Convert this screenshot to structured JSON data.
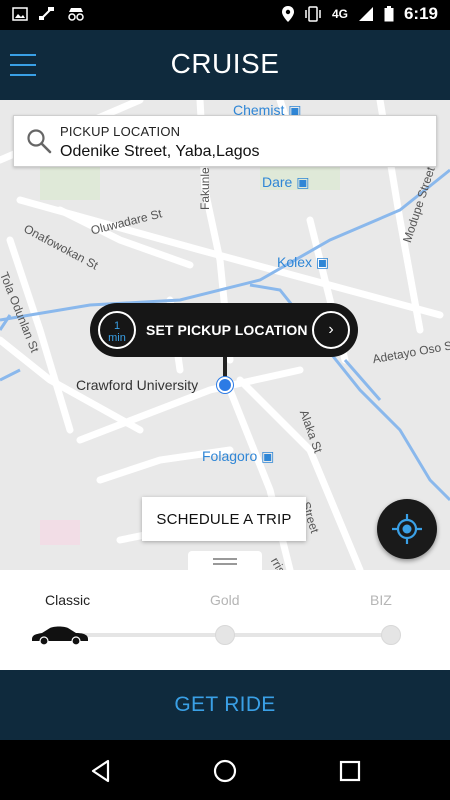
{
  "status_bar": {
    "network": "4G",
    "time": "6:19",
    "left_icons": [
      "image-icon",
      "satellite-icon",
      "incognito-icon"
    ],
    "right_icons": [
      "location-icon",
      "vibrate-icon",
      "signal-icon",
      "battery-icon"
    ]
  },
  "header": {
    "title": "CRUISE",
    "menu_icon": "hamburger-icon"
  },
  "map": {
    "streets": [
      "Oluwadare St",
      "Onafowokan St",
      "Fakunle Street",
      "Tola Odunlan St",
      "Modupe Street",
      "Adetayo Oso St",
      "Alaka St",
      "Street",
      "rris St"
    ],
    "places": {
      "chemist": "Chemist",
      "dare": "Dare",
      "kolex": "Kolex",
      "folagoro": "Folagoro",
      "crawford": "Crawford University"
    }
  },
  "pickup": {
    "label": "PICKUP LOCATION",
    "value": "Odenike Street, Yaba,Lagos",
    "icon": "search-icon"
  },
  "pickup_pill": {
    "eta_number": "1",
    "eta_unit": "min",
    "label": "SET PICKUP LOCATION",
    "arrow": "›"
  },
  "schedule_button": "SCHEDULE A TRIP",
  "locate_icon": "my-location-icon",
  "ride_options": {
    "classic": "Classic",
    "gold": "Gold",
    "biz": "BIZ",
    "selected": "Classic"
  },
  "get_ride_button": "GET RIDE",
  "nav": {
    "back": "back-icon",
    "home": "home-icon",
    "recent": "recent-apps-icon"
  },
  "colors": {
    "header_bg": "#0f2a3d",
    "accent": "#3aa0e6",
    "map_bg": "#e8e8e8",
    "road_blue": "#7fb3e8"
  }
}
